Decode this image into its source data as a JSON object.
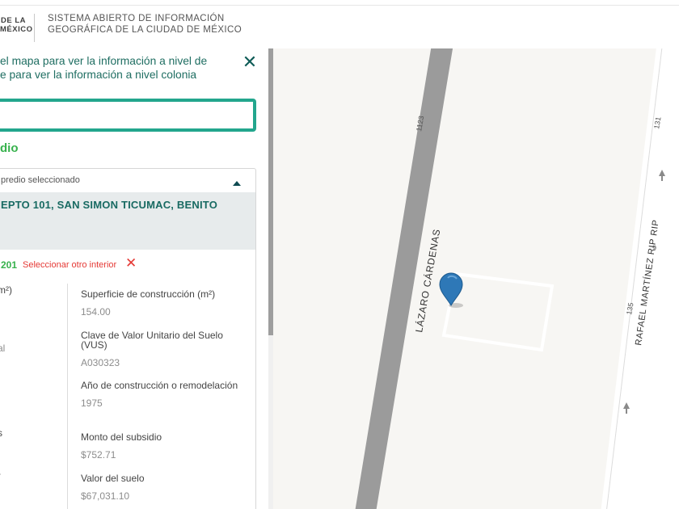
{
  "header": {
    "logo_line1": "DE LA",
    "logo_line2": "MÉXICO",
    "title_line1": "SISTEMA ABIERTO DE INFORMACIÓN",
    "title_line2": "GEOGRÁFICA DE LA CIUDAD DE MÉXICO"
  },
  "panel": {
    "instruction_line1": "el mapa para ver la información a nivel de",
    "instruction_line2": "e para ver la información a nivel colonia",
    "close_icon": "close-icon",
    "search_value": "",
    "section_title": "dio",
    "card": {
      "header_label": "predio seleccionado",
      "address": "EPTO 101, SAN SIMON TICUMAC, BENITO",
      "interior_number": "201",
      "select_other_label": "Seleccionar otro interior",
      "remove_icon": "remove-icon"
    },
    "left_fragments": [
      {
        "text": "m²)",
        "gray": false
      },
      {
        "text": "al",
        "gray": true
      },
      {
        "text": "l",
        "gray": false
      },
      {
        "text": "s",
        "gray": false
      },
      {
        "text": "-",
        "gray": false
      }
    ],
    "fields": [
      {
        "label": "Superficie de construcción (m²)",
        "value": "154.00"
      },
      {
        "label": "Clave de Valor Unitario del Suelo (VUS)",
        "value": "A030323"
      },
      {
        "label": "Año de construcción o remodelación",
        "value": "1975"
      },
      {
        "label": "Monto del subsidio",
        "value": "$752.71"
      },
      {
        "label": "Valor del suelo",
        "value": "$67,031.10"
      }
    ]
  },
  "map": {
    "street_main": "LÁZARO CÁRDENAS",
    "street_side": "RAFAEL MARTÍNEZ RIP RIP",
    "number_1123": "1123",
    "number_131": "131",
    "number_135": "135",
    "number_9": "9",
    "road_color": "#9b9b9b",
    "marker_color": "#2e78b7",
    "marker_icon": "map-pin-icon"
  }
}
